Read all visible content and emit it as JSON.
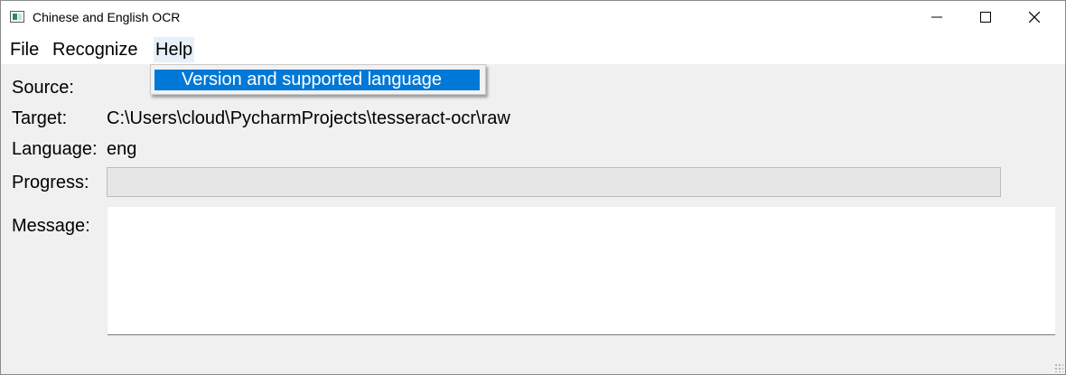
{
  "window": {
    "title": "Chinese and English OCR",
    "icons": {
      "app": "ocr-window-icon",
      "minimize": "minimize-icon",
      "maximize": "maximize-icon",
      "close": "close-icon"
    }
  },
  "menubar": {
    "items": [
      {
        "label": "File"
      },
      {
        "label": "Recognize"
      },
      {
        "label": "Help"
      }
    ],
    "open_menu": "Help"
  },
  "help_menu": {
    "items": [
      {
        "label": "Version and supported language",
        "highlighted": true
      }
    ]
  },
  "form": {
    "source_label": "Source:",
    "source_value": "",
    "target_label": "Target:",
    "target_value": "C:\\Users\\cloud\\PycharmProjects\\tesseract-ocr\\raw",
    "language_label": "Language:",
    "language_value": "eng",
    "progress_label": "Progress:",
    "progress_value": 0,
    "message_label": "Message:",
    "message_text": ""
  },
  "colors": {
    "highlight": "#0078d7",
    "menu_active_bg": "#e5f0fa",
    "window_bg": "#f0f0f0"
  }
}
